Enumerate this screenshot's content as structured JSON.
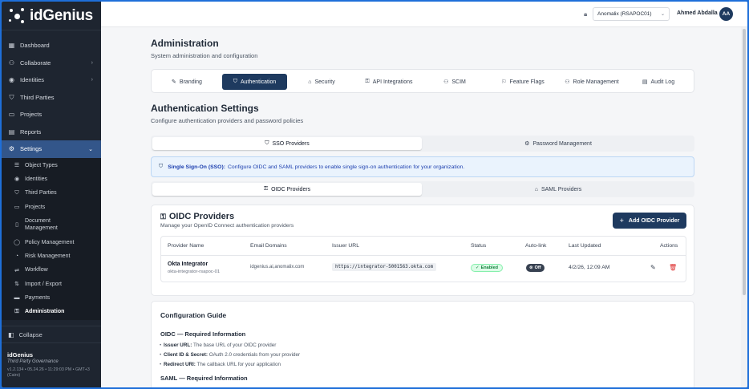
{
  "app": {
    "name": "idGenius"
  },
  "sidebar": {
    "items": [
      {
        "label": "Dashboard",
        "icon": "grid-icon"
      },
      {
        "label": "Collaborate",
        "icon": "users-icon",
        "chevron": "›"
      },
      {
        "label": "Identities",
        "icon": "id-icon",
        "chevron": "›"
      },
      {
        "label": "Third Parties",
        "icon": "shield-icon"
      },
      {
        "label": "Projects",
        "icon": "folder-icon"
      },
      {
        "label": "Reports",
        "icon": "report-icon"
      },
      {
        "label": "Settings",
        "icon": "gear-icon",
        "chevron": "⌄"
      }
    ],
    "sub_items": [
      {
        "label": "Object Types"
      },
      {
        "label": "Identities"
      },
      {
        "label": "Third Parties"
      },
      {
        "label": "Projects"
      },
      {
        "label": "Document Management"
      },
      {
        "label": "Policy Management"
      },
      {
        "label": "Risk Management"
      },
      {
        "label": "Workflow"
      },
      {
        "label": "Import / Export"
      },
      {
        "label": "Payments"
      },
      {
        "label": "Administration"
      }
    ],
    "collapse_label": "Collapse",
    "footer": {
      "name": "idGenius",
      "tagline": "Third Party Governance",
      "version": "v1.2.134 • 05.24.26 • 11:29:03 PM • GMT+3 (Cairo)"
    }
  },
  "topbar": {
    "org": "Anomalix (RSAPOC01)",
    "user": "Ahmed Abdalla",
    "initials": "AA"
  },
  "admin": {
    "title": "Administration",
    "subtitle": "System administration and configuration",
    "tabs": [
      {
        "label": "Branding"
      },
      {
        "label": "Authentication"
      },
      {
        "label": "Security"
      },
      {
        "label": "API Integrations"
      },
      {
        "label": "SCIM"
      },
      {
        "label": "Feature Flags"
      },
      {
        "label": "Role Management"
      },
      {
        "label": "Audit Log"
      }
    ]
  },
  "auth": {
    "title": "Authentication Settings",
    "subtitle": "Configure authentication providers and password policies",
    "seg1": [
      "SSO Providers",
      "Password Management"
    ],
    "info_bold": "Single Sign-On (SSO):",
    "info_text": "Configure OIDC and SAML providers to enable single sign-on authentication for your organization.",
    "seg2": [
      "OIDC Providers",
      "SAML Providers"
    ]
  },
  "oidc": {
    "title": "OIDC Providers",
    "subtitle": "Manage your OpenID Connect authentication providers",
    "add_label": "Add OIDC Provider",
    "columns": [
      "Provider Name",
      "Email Domains",
      "Issuer URL",
      "Status",
      "Auto-link",
      "Last Updated",
      "Actions"
    ],
    "rows": [
      {
        "name": "Okta Integrator",
        "id": "okta-integrator-rsapoc-01",
        "domains": "idgenius.ai,anomalix.com",
        "issuer": "https://integrator-5001563.okta.com",
        "status": "Enabled",
        "autolink": "Off",
        "updated": "4/2/26, 12:09 AM"
      }
    ]
  },
  "guide": {
    "title": "Configuration Guide",
    "oidc_heading": "OIDC — Required Information",
    "items": [
      {
        "term": "Issuer URL:",
        "desc": "The base URL of your OIDC provider"
      },
      {
        "term": "Client ID & Secret:",
        "desc": "OAuth 2.0 credentials from your provider"
      },
      {
        "term": "Redirect URI:",
        "desc": "The callback URL for your application"
      }
    ],
    "saml_heading": "SAML — Required Information"
  },
  "colors": {
    "sidebar_bg": "#1e2530",
    "sidebar_active": "#33568a",
    "primary": "#1e3a5f",
    "enabled_green": "#15803d",
    "delete_red": "#dc2626",
    "frame_border": "#1e6fd9"
  }
}
